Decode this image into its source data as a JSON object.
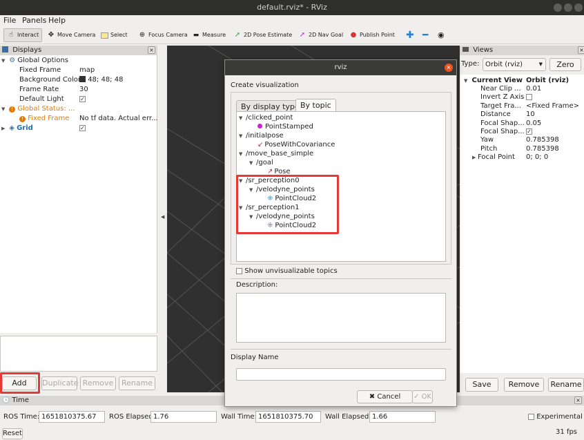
{
  "window": {
    "title": "default.rviz* - RViz"
  },
  "menu": [
    "File",
    "Panels",
    "Help"
  ],
  "toolbar": {
    "interact": "Interact",
    "move_camera": "Move Camera",
    "select": "Select",
    "focus_camera": "Focus Camera",
    "measure": "Measure",
    "pose_estimate": "2D Pose Estimate",
    "nav_goal": "2D Nav Goal",
    "publish_point": "Publish Point"
  },
  "displays": {
    "title": "Displays",
    "global_options": "Global Options",
    "fixed_frame_label": "Fixed Frame",
    "fixed_frame_value": "map",
    "bg_color_label": "Background Color",
    "bg_color_value": "48; 48; 48",
    "frame_rate_label": "Frame Rate",
    "frame_rate_value": "30",
    "default_light_label": "Default Light",
    "global_status": "Global Status: ...",
    "fixed_frame_status": "Fixed Frame",
    "fixed_frame_status_value": "No tf data.  Actual err...",
    "grid": "Grid",
    "buttons": {
      "add": "Add",
      "duplicate": "Duplicate",
      "remove": "Remove",
      "rename": "Rename"
    }
  },
  "views": {
    "title": "Views",
    "type_label": "Type:",
    "type_value": "Orbit (rviz)",
    "zero": "Zero",
    "current_view": "Current View",
    "current_view_value": "Orbit (rviz)",
    "rows": [
      {
        "label": "Near Clip ...",
        "value": "0.01"
      },
      {
        "label": "Invert Z Axis",
        "value": ""
      },
      {
        "label": "Target Fra...",
        "value": "<Fixed Frame>"
      },
      {
        "label": "Distance",
        "value": "10"
      },
      {
        "label": "Focal Shap...",
        "value": "0.05"
      },
      {
        "label": "Focal Shap...",
        "value": ""
      },
      {
        "label": "Yaw",
        "value": "0.785398"
      },
      {
        "label": "Pitch",
        "value": "0.785398"
      },
      {
        "label": "Focal Point",
        "value": "0; 0; 0"
      }
    ],
    "buttons": {
      "save": "Save",
      "remove": "Remove",
      "rename": "Rename"
    }
  },
  "time": {
    "title": "Time",
    "ros_time_label": "ROS Time:",
    "ros_time_value": "1651810375.67",
    "ros_elapsed_label": "ROS Elapsed:",
    "ros_elapsed_value": "1.76",
    "wall_time_label": "Wall Time:",
    "wall_time_value": "1651810375.70",
    "wall_elapsed_label": "Wall Elapsed:",
    "wall_elapsed_value": "1.66",
    "experimental": "Experimental",
    "reset": "Reset",
    "fps": "31 fps"
  },
  "dialog": {
    "title": "rviz",
    "heading": "Create visualization",
    "tab_display_type": "By display type",
    "tab_topic": "By topic",
    "topics": {
      "clicked_point": "/clicked_point",
      "point_stamped": "PointStamped",
      "initialpose": "/initialpose",
      "pose_with_cov": "PoseWithCovariance",
      "move_base_simple": "/move_base_simple",
      "goal": "/goal",
      "pose": "Pose",
      "sr_perception0": "/sr_perception0",
      "velodyne0": "/velodyne_points",
      "pointcloud0": "PointCloud2",
      "sr_perception1": "/sr_perception1",
      "velodyne1": "/velodyne_points",
      "pointcloud1": "PointCloud2"
    },
    "show_unvisualizable": "Show unvisualizable topics",
    "description_label": "Description:",
    "display_name_label": "Display Name",
    "cancel": "Cancel",
    "ok": "OK"
  },
  "colors": {
    "highlight": "#e53935",
    "background_3d": "#303030",
    "warning": "#e07b00"
  }
}
